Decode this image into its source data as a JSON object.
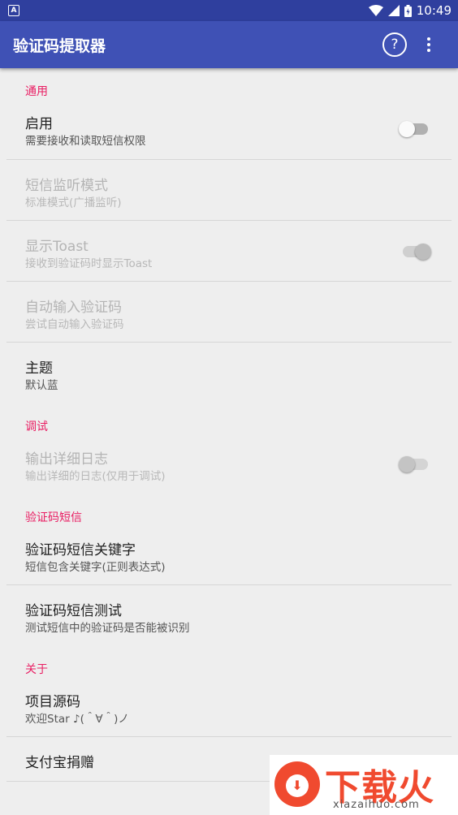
{
  "status_bar": {
    "time": "10:49",
    "app_icon_letter": "A"
  },
  "app_bar": {
    "title": "验证码提取器",
    "help_glyph": "?"
  },
  "sections": {
    "general": {
      "header": "通用"
    },
    "debug": {
      "header": "调试"
    },
    "sms": {
      "header": "验证码短信"
    },
    "about": {
      "header": "关于"
    }
  },
  "prefs": {
    "enable": {
      "title": "启用",
      "summary": "需要接收和读取短信权限",
      "checked": false,
      "enabled": true
    },
    "listen_mode": {
      "title": "短信监听模式",
      "summary": "标准模式(广播监听)",
      "enabled": false
    },
    "show_toast": {
      "title": "显示Toast",
      "summary": "接收到验证码时显示Toast",
      "checked": true,
      "enabled": false
    },
    "auto_input": {
      "title": "自动输入验证码",
      "summary": "尝试自动输入验证码",
      "enabled": false
    },
    "theme": {
      "title": "主题",
      "summary": "默认蓝"
    },
    "verbose_log": {
      "title": "输出详细日志",
      "summary": "输出详细的日志(仅用于调试)",
      "checked": false,
      "enabled": false
    },
    "keywords": {
      "title": "验证码短信关键字",
      "summary": "短信包含关键字(正则表达式)"
    },
    "sms_test": {
      "title": "验证码短信测试",
      "summary": "测试短信中的验证码是否能被识别"
    },
    "source": {
      "title": "项目源码",
      "summary": "欢迎Star ♪(＾∀＾)ノ"
    },
    "donate": {
      "title": "支付宝捐赠"
    }
  },
  "watermark": {
    "brand": "下载火",
    "site": "xiazaihuo.com"
  },
  "colors": {
    "primary": "#3f51b5",
    "primary_dark": "#2f3f9e",
    "accent": "#e91e63"
  }
}
